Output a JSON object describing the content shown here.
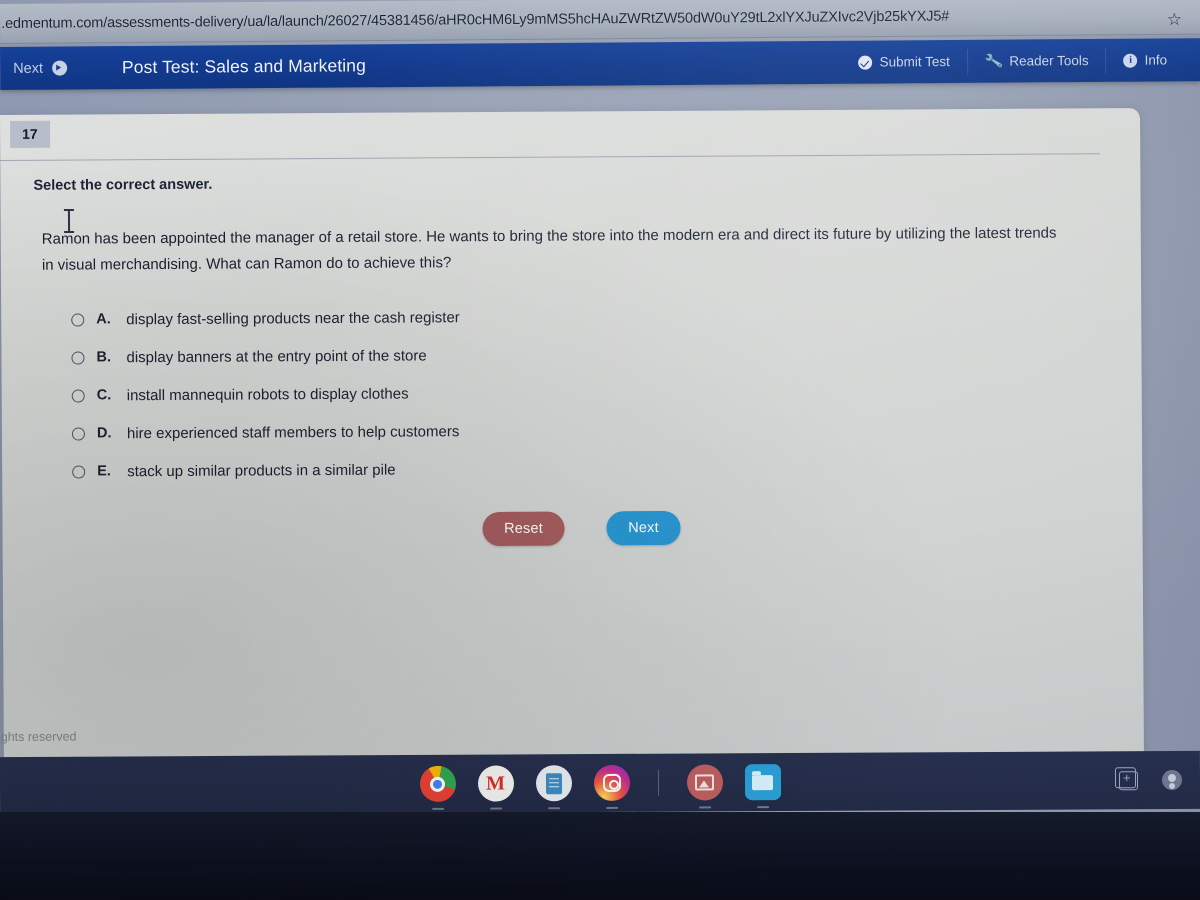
{
  "browser": {
    "url": ".edmentum.com/assessments-delivery/ua/la/launch/26027/45381456/aHR0cHM6Ly9mMS5hcHAuZWRtZW50dW0uY29tL2xlYXJuZXIvc2Vjb25kYXJ5#",
    "bookmark_icon": "star-icon",
    "bookmark_glyph": "☆"
  },
  "appbar": {
    "next_label": "Next",
    "next_icon": "arrow-circle-right-icon",
    "title": "Post Test: Sales and Marketing",
    "actions": [
      {
        "label": "Submit Test",
        "icon": "check-circle-icon"
      },
      {
        "label": "Reader Tools",
        "icon": "wrench-icon"
      },
      {
        "label": "Info",
        "icon": "info-circle-icon"
      }
    ]
  },
  "question": {
    "number": "17",
    "instruction": "Select the correct answer.",
    "stem": "Ramon has been appointed the manager of a retail store. He wants to bring the store into the modern era and direct its future by utilizing the latest trends in visual merchandising. What can Ramon do to achieve this?",
    "options": [
      {
        "letter": "A.",
        "text": "display fast-selling products near the cash register",
        "selected": false
      },
      {
        "letter": "B.",
        "text": "display banners at the entry point of the store",
        "selected": false
      },
      {
        "letter": "C.",
        "text": "install mannequin robots to display clothes",
        "selected": false
      },
      {
        "letter": "D.",
        "text": "hire experienced staff members to help customers",
        "selected": false
      },
      {
        "letter": "E.",
        "text": "stack up similar products in a similar pile",
        "selected": false
      }
    ]
  },
  "buttons": {
    "reset": "Reset",
    "next": "Next",
    "reset_color": "#a45a5c",
    "next_color": "#2394d2"
  },
  "footer": {
    "text": "rights reserved"
  },
  "taskbar": {
    "items": [
      {
        "name": "chrome-icon",
        "label": "Chrome"
      },
      {
        "name": "gmail-icon",
        "label": "Gmail",
        "glyph": "M"
      },
      {
        "name": "docs-icon",
        "label": "Docs"
      },
      {
        "name": "instagram-icon",
        "label": "Instagram"
      },
      {
        "name": "photos-icon",
        "label": "Photos"
      },
      {
        "name": "files-icon",
        "label": "Files"
      }
    ],
    "tray": [
      {
        "name": "screen-capture-icon",
        "label": "Screen capture"
      },
      {
        "name": "avatar-icon",
        "label": "User account"
      }
    ]
  },
  "theme": {
    "appbar_blue": "#123a8e",
    "card_bg": "#d6d8d6",
    "badge_bg": "#b7bdc9"
  }
}
